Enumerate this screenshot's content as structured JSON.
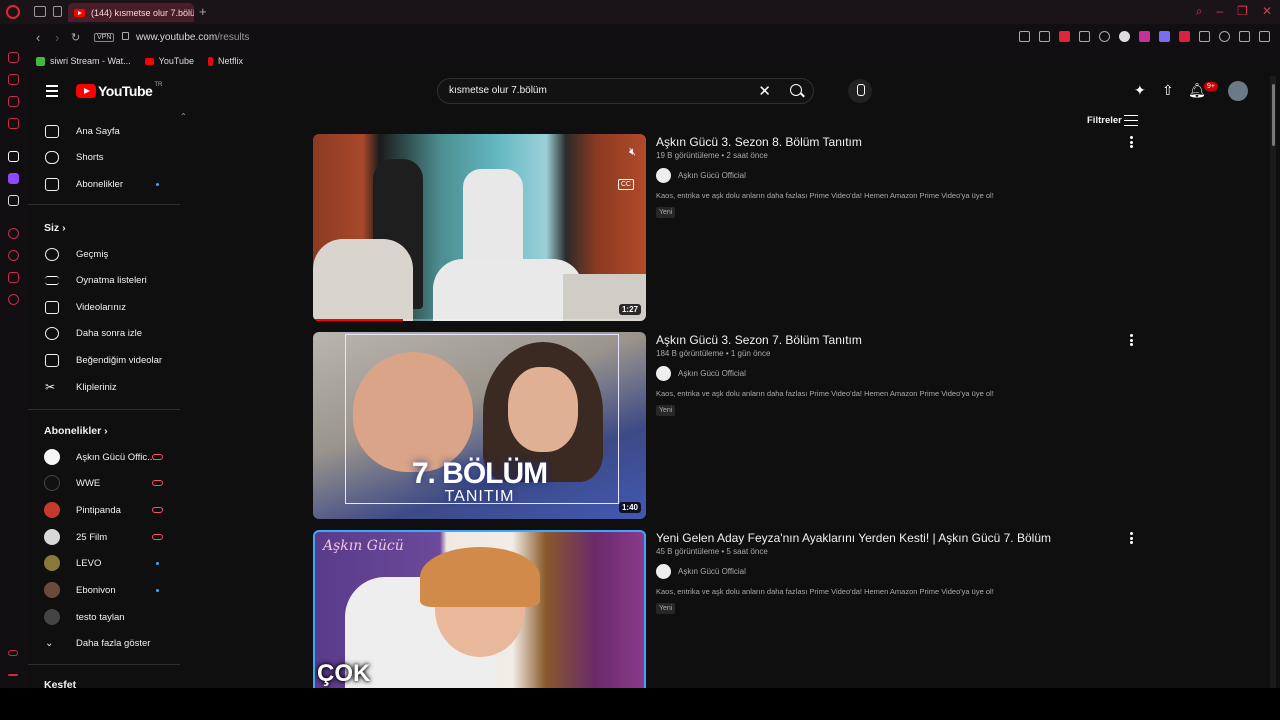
{
  "browser": {
    "tab_title": "(144) kısmetse olur 7.bölü",
    "url_domain": "www.youtube.com",
    "url_path": "/results",
    "vpn_label": "VPN",
    "bookmarks": [
      {
        "label": "siwri Stream - Wat...",
        "color": "#3dbb3d"
      },
      {
        "label": "YouTube",
        "color": "#ff0000"
      },
      {
        "label": "Netflix",
        "color": "#e50914"
      }
    ]
  },
  "header": {
    "logo_text": "YouTube",
    "country_code": "TR",
    "search_query": "kısmetse olur 7.bölüm",
    "notification_count": "9+"
  },
  "sidebar": {
    "main": [
      {
        "label": "Ana Sayfa",
        "icon": "home-icon"
      },
      {
        "label": "Shorts",
        "icon": "shorts-icon"
      },
      {
        "label": "Abonelikler",
        "icon": "subscriptions-icon"
      }
    ],
    "you_heading": "Siz",
    "you": [
      {
        "label": "Geçmiş",
        "icon": "history-icon"
      },
      {
        "label": "Oynatma listeleri",
        "icon": "playlists-icon"
      },
      {
        "label": "Videolarınız",
        "icon": "your-videos-icon"
      },
      {
        "label": "Daha sonra izle",
        "icon": "watch-later-icon"
      },
      {
        "label": "Beğendiğim videolar",
        "icon": "liked-icon"
      },
      {
        "label": "Klipleriniz",
        "icon": "clips-icon"
      }
    ],
    "subs_heading": "Abonelikler",
    "subs": [
      {
        "label": "Aşkın Gücü Offic...",
        "status": "live",
        "color": "#f5f5f5"
      },
      {
        "label": "WWE",
        "status": "live",
        "color": "#111111"
      },
      {
        "label": "Pintipanda",
        "status": "live",
        "color": "#c63a2e"
      },
      {
        "label": "25 Film",
        "status": "live",
        "color": "#d8d8d8"
      },
      {
        "label": "LEVO",
        "status": "new",
        "color": "#8a7a3a"
      },
      {
        "label": "Ebonivon",
        "status": "new",
        "color": "#6a4a3a"
      },
      {
        "label": "testo taylan",
        "status": "",
        "color": "#444444"
      }
    ],
    "show_more": "Daha fazla göster",
    "explore_heading": "Keşfet"
  },
  "filters_label": "Filtreler",
  "results": [
    {
      "title": "Aşkın Gücü 3. Sezon 8. Bölüm Tanıtım",
      "meta": "19 B görüntüleme • 2 saat önce",
      "channel": "Aşkın Gücü Official",
      "description": "Kaos, entrika ve aşk dolu anların daha fazlası Prime Video'da! Hemen Amazon Prime Video'ya üye ol!",
      "badge": "Yeni",
      "duration": "1:27",
      "progress": 0.27
    },
    {
      "title": "Aşkın Gücü 3. Sezon 7. Bölüm Tanıtım",
      "meta": "184 B görüntüleme • 1 gün önce",
      "channel": "Aşkın Gücü Official",
      "description": "Kaos, entrika ve aşk dolu anların daha fazlası Prime Video'da! Hemen Amazon Prime Video'ya üye ol!",
      "badge": "Yeni",
      "duration": "1:40",
      "thumb_text_1": "7. BÖLÜM",
      "thumb_text_2": "TANITIM"
    },
    {
      "title": "Yeni Gelen Aday Feyza'nın Ayaklarını Yerden Kesti! | Aşkın Gücü 7. Bölüm",
      "meta": "45 B görüntüleme • 5 saat önce",
      "channel": "Aşkın Gücü Official",
      "description": "Kaos, entrika ve aşk dolu anların daha fazlası Prime Video'da! Hemen Amazon Prime Video'ya üye ol!",
      "badge": "Yeni",
      "thumb_script": "Aşkın Gücü",
      "thumb_text": "ÇOK"
    }
  ]
}
